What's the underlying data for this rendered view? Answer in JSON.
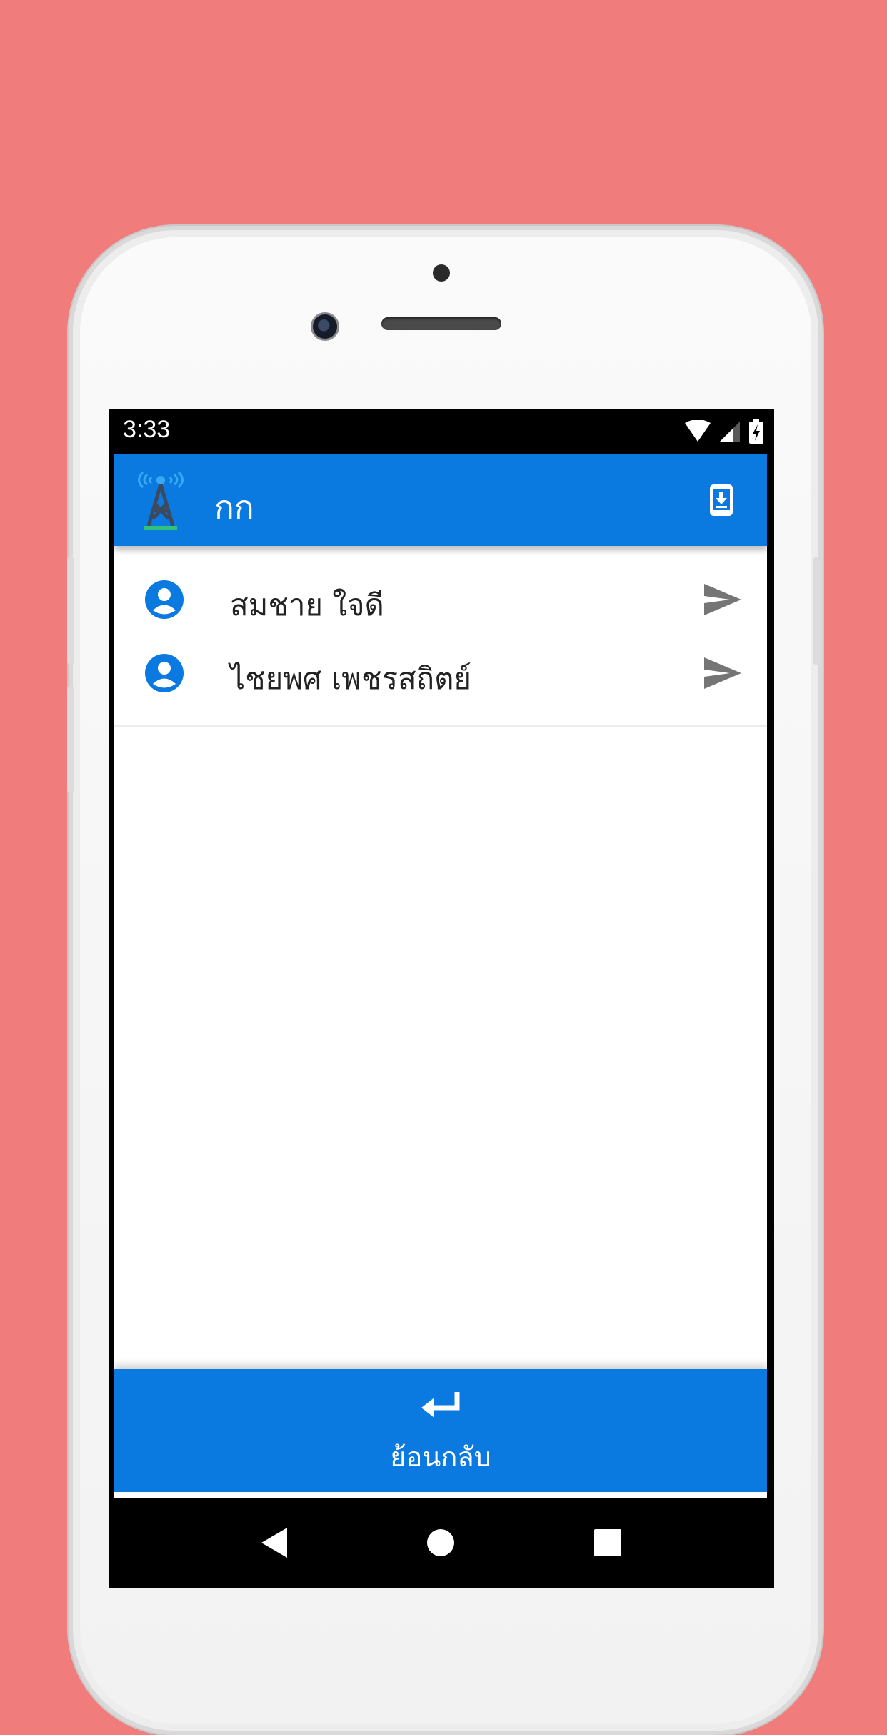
{
  "status_bar": {
    "time": "3:33"
  },
  "toolbar": {
    "title": "กก",
    "logo_icon": "signal-tower-icon",
    "action_icon": "phone-download-icon"
  },
  "contacts": [
    {
      "name": "สมชาย ใจดี",
      "avatar_icon": "account-circle-icon",
      "action_icon": "send-icon"
    },
    {
      "name": "ไชยพศ เพชรสถิตย์",
      "avatar_icon": "account-circle-icon",
      "action_icon": "send-icon"
    }
  ],
  "bottom_bar": {
    "back_label": "ย้อนกลับ",
    "back_icon": "return-arrow-icon"
  },
  "colors": {
    "background": "#f07d7c",
    "primary": "#0a79e0",
    "send_icon": "#757575"
  }
}
